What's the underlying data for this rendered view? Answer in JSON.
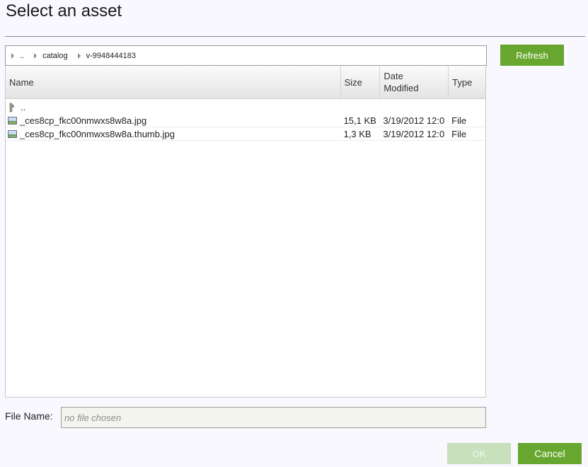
{
  "dialog": {
    "title": "Select an asset"
  },
  "breadcrumb": {
    "items": [
      {
        "label": ".."
      },
      {
        "label": "catalog"
      },
      {
        "label": "v-9948444183"
      }
    ]
  },
  "toolbar": {
    "refresh_label": "Refresh"
  },
  "grid": {
    "columns": {
      "name": "Name",
      "size": "Size",
      "date_line1": "Date",
      "date_line2": "Modified",
      "type": "Type"
    },
    "up_label": "..",
    "rows": [
      {
        "name": "_ces8cp_fkc00nmwxs8w8a.jpg",
        "size": "15,1 KB",
        "date": "3/19/2012 12:0",
        "type": "File",
        "icon": "image-file-icon"
      },
      {
        "name": "_ces8cp_fkc00nmwxs8w8a.thumb.jpg",
        "size": "1,3 KB",
        "date": "3/19/2012 12:0",
        "type": "File",
        "icon": "image-file-icon"
      }
    ]
  },
  "filename": {
    "label": "File Name:",
    "value": "",
    "placeholder": "no file chosen"
  },
  "actions": {
    "ok_label": "OK",
    "cancel_label": "Cancel"
  },
  "colors": {
    "accent": "#68a72f",
    "accent_disabled": "#c9e0bd"
  }
}
